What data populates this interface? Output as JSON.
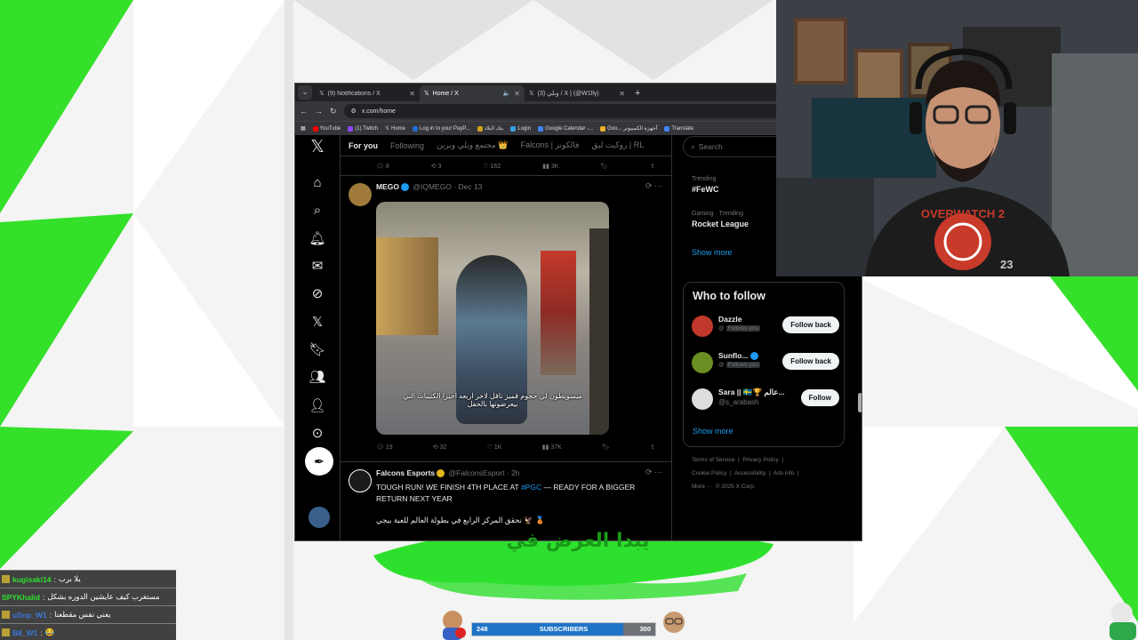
{
  "browser": {
    "tabs": [
      {
        "title": "(9) Notifications / X",
        "active": false
      },
      {
        "title": "Home / X",
        "active": true
      },
      {
        "title": "(3) وبلي / X | (@W1lly)",
        "active": false
      }
    ],
    "url": "x.com/home",
    "bookmarks": [
      "YouTube",
      "(1) Twitch",
      "Home",
      "Log in to your PayP...",
      "بنك البلاد",
      "Login",
      "Google Calendar -...",
      "Goo... أجهزة الكمبيوتر",
      "Translate"
    ]
  },
  "feed": {
    "tabs": [
      "For you",
      "Following",
      "مجتمع ويلي وبرين 👑",
      "Falcons | فالكونز",
      "روكيت ليق | RL"
    ],
    "top_actions": {
      "replies": "8",
      "reposts": "3",
      "likes": "162",
      "views": "3K"
    },
    "tweet1": {
      "name": "MEGO",
      "handle": "@IQMEGO",
      "date": "Dec 13",
      "subtitle": "ميسويطون لي حجوم قميز ناقل لاخر اربعه اخيرا الكتيبات التي بيعرضونها بالحفل",
      "replies": "19",
      "reposts": "32",
      "likes": "1K",
      "views": "37K"
    },
    "tweet2": {
      "name": "Falcons Esports",
      "handle": "@FalconsEsport",
      "time": "2h",
      "text_a": "TOUGH RUN! WE FINISH 4TH PLACE AT ",
      "hashtag": "#PGC",
      "text_b": " — READY FOR A BIGGER RETURN NEXT YEAR",
      "text_ar": "🥉 🦅 نحقق المركز الرابع في بطولة العالم للعبة ببجي"
    }
  },
  "sidebar": {
    "search_placeholder": "Search",
    "trends": [
      {
        "label": "Trending",
        "name": "#FeWC"
      },
      {
        "label": "Gaming · Trending",
        "name": "Rocket League"
      }
    ],
    "show_more": "Show more",
    "who_to_follow": {
      "title": "Who to follow",
      "users": [
        {
          "name": "Dazzle",
          "handle": "@",
          "note": "Follows you",
          "button": "Follow back"
        },
        {
          "name": "Sunflo...",
          "handle": "@",
          "note": "Follows you",
          "button": "Follow back"
        },
        {
          "name": "Sara || 🇸🇪🏆 عالم...",
          "handle": "@s_arabash",
          "note": "",
          "button": "Follow"
        }
      ],
      "show_more": "Show more"
    },
    "footer": [
      "Terms of Service",
      "Privacy Policy",
      "Cookie Policy",
      "Accessibility",
      "Ads info",
      "More ···",
      "© 2025 X Corp."
    ]
  },
  "stream": {
    "chat": [
      {
        "user": "kugisaki14",
        "msg": "يلا برب"
      },
      {
        "user": "SPYKhalid",
        "msg": "مستغرب كيف عايشين الدوره بشكل"
      },
      {
        "user": "uSnp_W1",
        "msg": "يعني نفس مقطعنا"
      },
      {
        "user": "B8_W1",
        "msg": "😂"
      }
    ],
    "subs_current": "248",
    "subs_label": "SUBSCRIBERS",
    "subs_goal": "300",
    "banner_text": "يبدا العرض في",
    "cam_badge": "23",
    "cam_shirt": "OVERWATCH 2"
  },
  "colors": {
    "accent": "#1d9bf0",
    "green": "#2ee02e",
    "bg": "#000000"
  }
}
